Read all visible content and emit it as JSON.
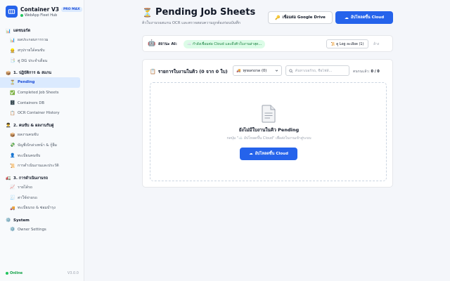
{
  "brand": {
    "title": "Container V3",
    "badge": "PRO MAX",
    "subtitle": "WebApp Fleet Hub"
  },
  "sidebar": {
    "sections": [
      {
        "icon": "📊",
        "label": "แดชบอร์ด",
        "items": [
          {
            "icon": "📊",
            "label": "ผลประกอบการรวม"
          },
          {
            "icon": "👷",
            "label": "สรุปรายได้คนขับ"
          },
          {
            "icon": "📑",
            "label": "คู่ DG ประจำเดือน"
          }
        ]
      },
      {
        "icon": "📦",
        "label": "1. ปฏิบัติการ & สแกน",
        "items": [
          {
            "icon": "⏳",
            "label": "Pending",
            "active": true
          },
          {
            "icon": "✅",
            "label": "Completed Job Sheets"
          },
          {
            "icon": "🗄️",
            "label": "Containers DB"
          },
          {
            "icon": "📋",
            "label": "OCR Container History"
          }
        ]
      },
      {
        "icon": "👨‍✈️",
        "label": "2. คนขับ & ผลงานรับคู่",
        "items": [
          {
            "icon": "📦",
            "label": "ผลงานคนขับ"
          },
          {
            "icon": "💸",
            "label": "บัญชีเบิกล่วงหน้า & กู้ยืม"
          },
          {
            "icon": "👤",
            "label": "ทะเบียนคนขับ"
          },
          {
            "icon": "📜",
            "label": "การดำเนินงานและประวัติ"
          }
        ]
      },
      {
        "icon": "🚛",
        "label": "3. การดำเนินงานรถ",
        "items": [
          {
            "icon": "📈",
            "label": "รายได้รถ"
          },
          {
            "icon": "🧾",
            "label": "ค่าใช้จ่ายรถ"
          },
          {
            "icon": "🚚",
            "label": "ทะเบียนรถ & ซ่อมบำรุง"
          }
        ]
      },
      {
        "icon": "⚙️",
        "label": "System",
        "items": [
          {
            "icon": "⚙️",
            "label": "Owner Settings"
          }
        ]
      }
    ],
    "footer": {
      "status": "Online",
      "version": "V3.0.0"
    }
  },
  "header": {
    "icon": "⏳",
    "title": "Pending Job Sheets",
    "subtitle": "คิวใบงานรอสแกน OCR และตรวจสอบความถูกต้องก่อนบันทึก",
    "drive_button": "เชื่อมต่อ Google Drive",
    "cloud_button": "อัปโหลดขึ้น Cloud"
  },
  "ai": {
    "label": "สถานะ AI:",
    "status": "☁️ กำลังเชื่อมต่อ Cloud และดึงคิวใบงานล่าสุด...",
    "log_button": "📜 ดู Log ละเอียด (1)",
    "clear": "ล้าง"
  },
  "queue": {
    "title": "รายการใบงานในคิว (0 จาก 0 ใบ)",
    "filter": "ทุกผลรถรด (0)",
    "search_placeholder": "ค้นหาเบอร์รถ, ชื่อไฟล์...",
    "count_label": "ตนกนแล้ว:",
    "count_value": "0 / 0",
    "empty_title": "ยังไม่มีใบงานในคิว Pending",
    "empty_sub": "กดปุ่ม \"☁️ อัปโหลดขึ้น Cloud\" เพื่อส่งใบงานเข้าสู่ระบบ",
    "upload_button": "อัปโหลดขึ้น Cloud"
  },
  "colors": {
    "accent": "#2563eb",
    "success": "#16a34a",
    "active_bg": "#dbeafe"
  }
}
